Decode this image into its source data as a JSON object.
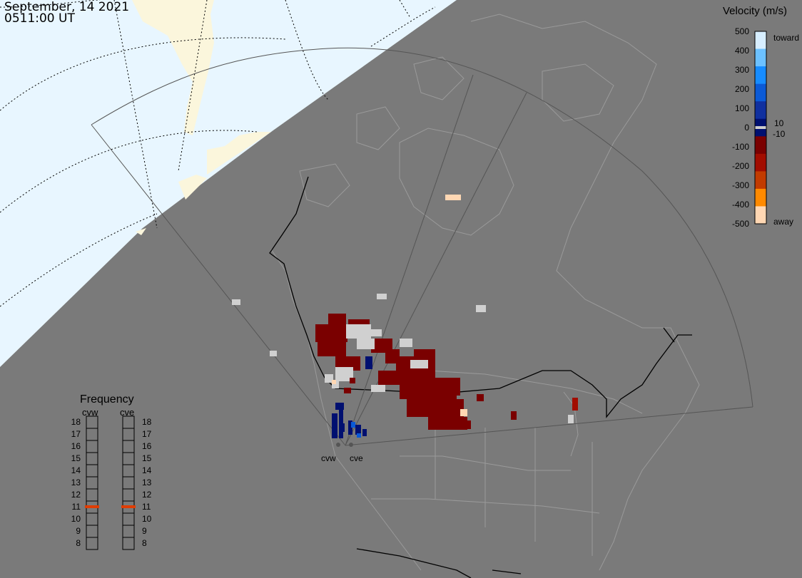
{
  "header": {
    "date": "September, 14 2021",
    "time": "0511:00 UT"
  },
  "velocity_scale": {
    "title": "Velocity (m/s)",
    "ticks": [
      "500",
      "400",
      "300",
      "200",
      "100",
      "0",
      "-100",
      "-200",
      "-300",
      "-400",
      "-500"
    ],
    "near_zero": [
      "10",
      "-10"
    ],
    "toward_label": "toward",
    "away_label": "away",
    "colors": [
      "#d7eeff",
      "#6cc1ff",
      "#168cff",
      "#0b5ad6",
      "#10309f",
      "#001070",
      "#7a0000",
      "#a20d00",
      "#c23b00",
      "#ff8a00",
      "#ffd7b3"
    ]
  },
  "frequency": {
    "title": "Frequency",
    "radars": [
      "cvw",
      "cve"
    ],
    "levels": [
      "18",
      "17",
      "16",
      "15",
      "14",
      "13",
      "12",
      "11",
      "10",
      "9",
      "8"
    ],
    "current_mhz": 11,
    "marker_color": "#e03c00"
  },
  "radars": [
    "cvw",
    "cve"
  ],
  "colors": {
    "land": "#7a7a7a",
    "daylight": "#e8f6ff",
    "daylight_land": "#fbf6dc",
    "boundary": "#9a9a9a"
  }
}
